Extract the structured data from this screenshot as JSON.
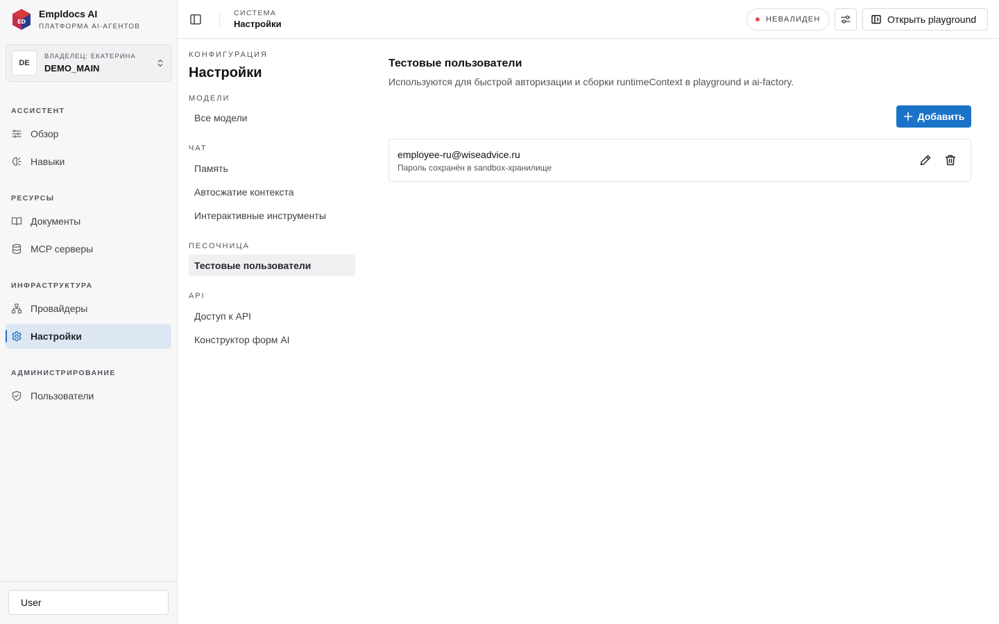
{
  "brand": {
    "name": "Empldocs AI",
    "subtitle": "ПЛАТФОРМА AI-АГЕНТОВ",
    "logo_text": "ED",
    "colors": {
      "red": "#d63b3b",
      "blue": "#2b3a8c"
    }
  },
  "owner": {
    "avatar": "DE",
    "label": "ВЛАДЕЛЕЦ: ЕКАТЕРИНА",
    "value": "DEMO_MAIN"
  },
  "sidebar": {
    "sections": [
      {
        "title": "АССИСТЕНТ"
      },
      {
        "title": "РЕСУРСЫ"
      },
      {
        "title": "ИНФРАСТРУКТУРА"
      },
      {
        "title": "АДМИНИСТРИРОВАНИЕ"
      }
    ],
    "items": [
      {
        "label": "Обзор",
        "icon": "sliders-icon"
      },
      {
        "label": "Навыки",
        "icon": "brain-icon"
      },
      {
        "label": "Документы",
        "icon": "book-icon"
      },
      {
        "label": "MCP серверы",
        "icon": "database-icon"
      },
      {
        "label": "Провайдеры",
        "icon": "network-icon"
      },
      {
        "label": "Настройки",
        "icon": "gear-icon",
        "active": true
      },
      {
        "label": "Пользователи",
        "icon": "shield-icon"
      }
    ],
    "accent": "#1a73c8"
  },
  "footer": {
    "user": "User"
  },
  "topbar": {
    "crumb_sup": "СИСТЕМА",
    "crumb_title": "Настройки",
    "status": "НЕВАЛИДЕН",
    "status_color": "#e5484d",
    "playground": "Открыть playground"
  },
  "subnav": {
    "sup": "КОНФИГУРАЦИЯ",
    "title": "Настройки",
    "sections": [
      {
        "title": "МОДЕЛИ",
        "items": [
          "Все модели"
        ]
      },
      {
        "title": "ЧАТ",
        "items": [
          "Память",
          "Автосжатие контекста",
          "Интерактивные инструменты"
        ]
      },
      {
        "title": "ПЕСОЧНИЦА",
        "items": [
          "Тестовые пользователи"
        ]
      },
      {
        "title": "API",
        "items": [
          "Доступ к API",
          "Конструктор форм AI"
        ]
      }
    ]
  },
  "main": {
    "title": "Тестовые пользователи",
    "description": "Используются для быстрой авторизации и сборки runtimeContext в playground и ai-factory.",
    "add_label": "Добавить",
    "users": [
      {
        "email": "employee-ru@wiseadvice.ru",
        "note": "Пароль сохранён в sandbox-хранилище"
      }
    ]
  }
}
